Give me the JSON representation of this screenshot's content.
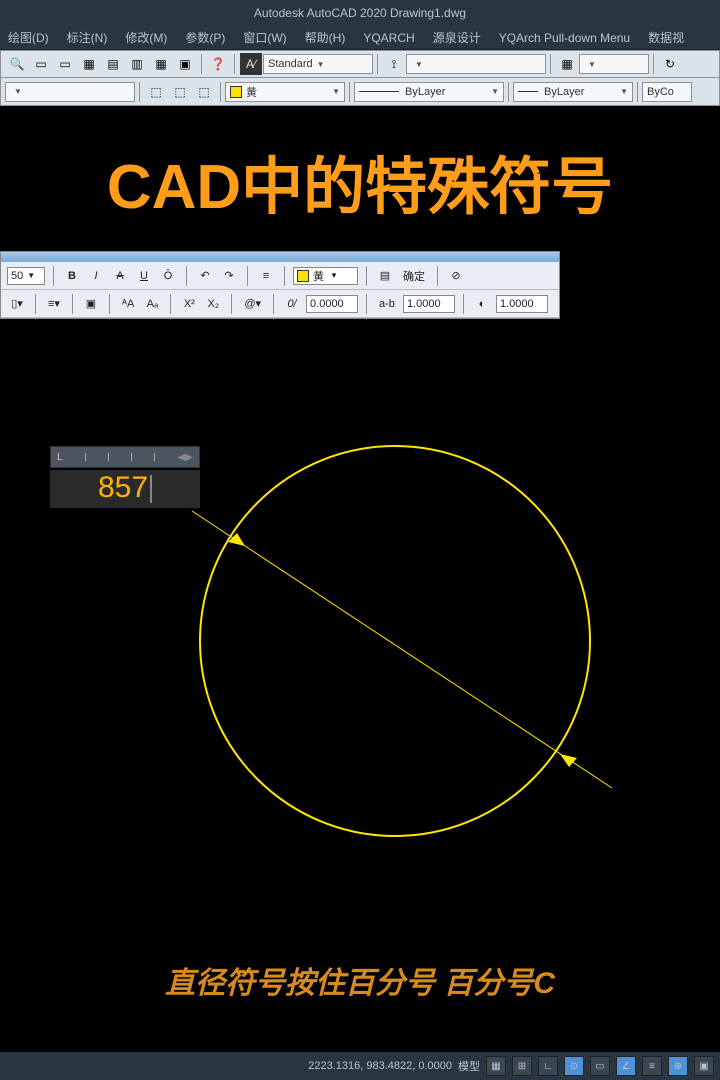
{
  "title": "Autodesk AutoCAD 2020   Drawing1.dwg",
  "menus": [
    "绘图(D)",
    "标注(N)",
    "修改(M)",
    "参数(P)",
    "窗口(W)",
    "帮助(H)",
    "YQARCH",
    "源泉设计",
    "YQArch Pull-down Menu",
    "数据视"
  ],
  "toolbar1": {
    "styleCombo": "Standard",
    "emptyCombo": "",
    "rightCombo": ""
  },
  "toolbar2": {
    "layerCombo": "",
    "colorName": "黄",
    "ltCombo": "ByLayer",
    "lwCombo": "ByLayer",
    "plotCombo": "ByCo"
  },
  "overlay": {
    "title": "CAD中的特殊符号",
    "subtitle": "直径符号按住百分号 百分号C"
  },
  "mtext": {
    "size": "50",
    "colorName": "黄",
    "okLabel": "确定",
    "oblique": "0.0000",
    "tracking": "1.0000",
    "width": "1.0000"
  },
  "dimension": {
    "value": "857"
  },
  "status": {
    "coords": "2223.1316, 983.4822, 0.0000",
    "model": "模型"
  }
}
